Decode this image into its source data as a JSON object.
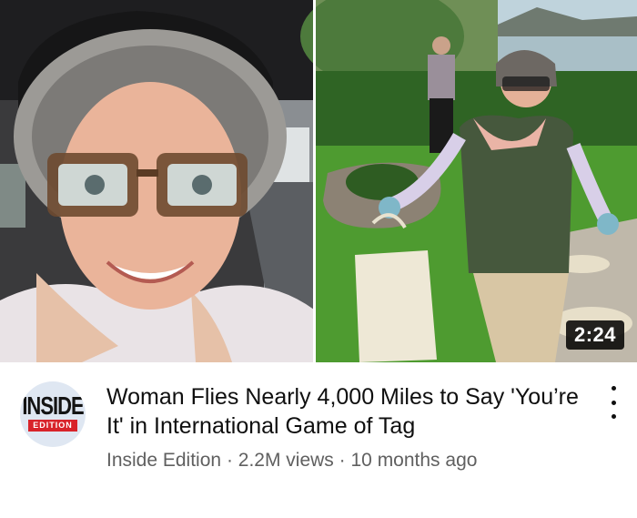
{
  "video": {
    "duration": "2:24",
    "title": "Woman Flies Nearly 4,000 Miles to Say 'You’re It' in International Game of Tag",
    "channel": "Inside Edition",
    "separator": "·",
    "views": "2.2M views",
    "age": "10 months ago"
  },
  "avatar": {
    "logo_top": "INSIDE",
    "logo_bottom": "EDITION"
  },
  "icons": {
    "more_menu": "three-dots-vertical-icon"
  },
  "colors": {
    "title": "#0f0f0f",
    "meta": "#606060",
    "duration_bg": "#000000",
    "logo_red": "#d8232a"
  }
}
